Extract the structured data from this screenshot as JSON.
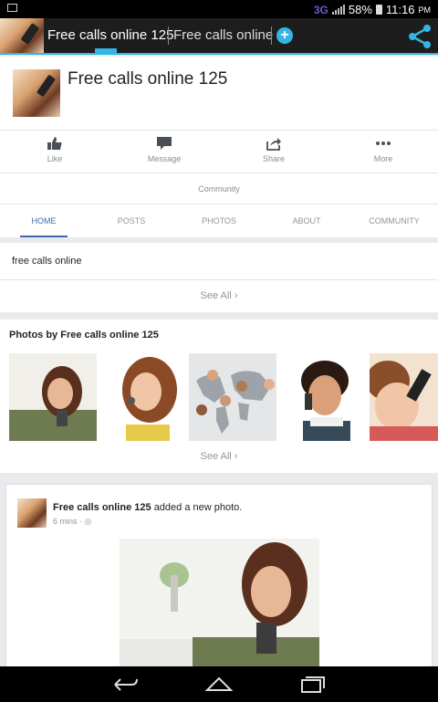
{
  "status_bar": {
    "network": "3G",
    "battery": "58%",
    "time": "11:16",
    "ampm": "PM"
  },
  "action_bar": {
    "tabs": [
      {
        "label": "Free calls online 125"
      },
      {
        "label": "Free calls online"
      }
    ]
  },
  "page": {
    "title": "Free calls online 125"
  },
  "actions": [
    {
      "label": "Like",
      "icon": "thumbs-up-icon"
    },
    {
      "label": "Message",
      "icon": "message-icon"
    },
    {
      "label": "Share",
      "icon": "share-arrow-icon"
    },
    {
      "label": "More",
      "icon": "more-dots-icon"
    }
  ],
  "category": "Community",
  "tabs": [
    {
      "label": "HOME"
    },
    {
      "label": "POSTS"
    },
    {
      "label": "PHOTOS"
    },
    {
      "label": "ABOUT"
    },
    {
      "label": "COMMUNITY"
    }
  ],
  "about": {
    "text": "free calls online",
    "see_all": "See All"
  },
  "photos": {
    "title": "Photos by Free calls online 125",
    "see_all": "See All"
  },
  "post": {
    "author": "Free calls online 125",
    "action": "added a new photo.",
    "time": "6 mins"
  },
  "colors": {
    "accent": "#33b5e5",
    "facebook_blue": "#4267b2",
    "text_gray": "#90949c"
  }
}
